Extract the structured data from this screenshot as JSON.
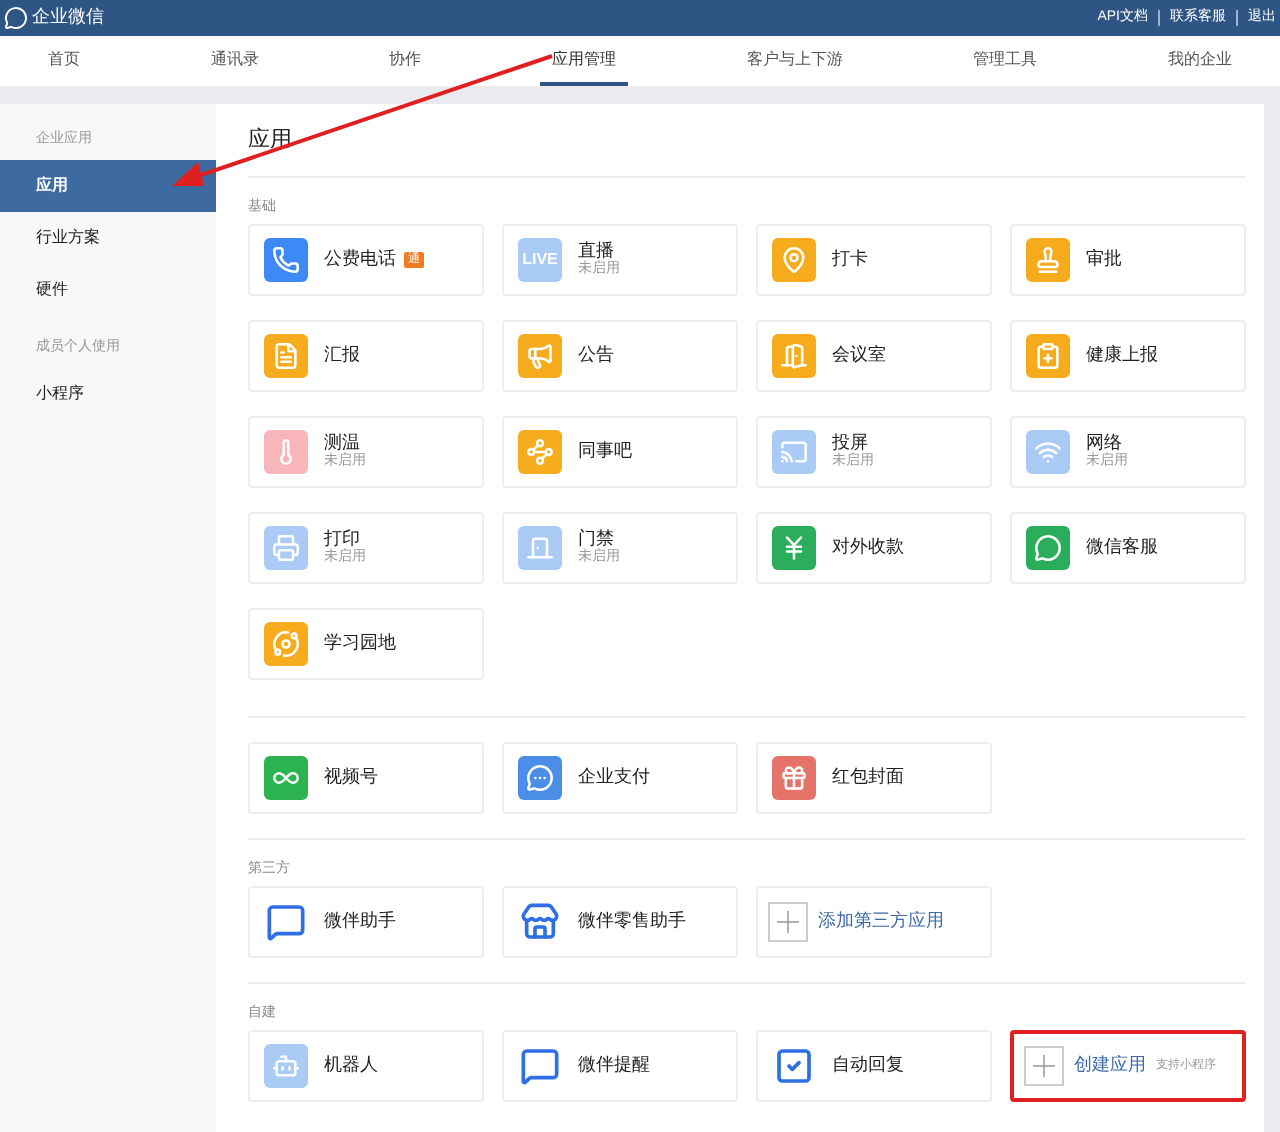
{
  "header": {
    "logo_text": "企业微信",
    "links": [
      "API文档",
      "联系客服",
      "退出"
    ]
  },
  "nav": {
    "tabs": [
      {
        "label": "首页",
        "selected": false
      },
      {
        "label": "通讯录",
        "selected": false
      },
      {
        "label": "协作",
        "selected": false
      },
      {
        "label": "应用管理",
        "selected": true
      },
      {
        "label": "客户与上下游",
        "selected": false
      },
      {
        "label": "管理工具",
        "selected": false
      },
      {
        "label": "我的企业",
        "selected": false
      }
    ]
  },
  "sidebar": {
    "items": [
      {
        "kind": "heading",
        "label": "企业应用"
      },
      {
        "kind": "item",
        "label": "应用",
        "selected": true
      },
      {
        "kind": "item",
        "label": "行业方案",
        "selected": false
      },
      {
        "kind": "item",
        "label": "硬件",
        "selected": false
      },
      {
        "kind": "heading",
        "label": "成员个人使用"
      },
      {
        "kind": "item",
        "label": "小程序",
        "selected": false
      }
    ]
  },
  "content": {
    "title": "应用",
    "sections": [
      {
        "heading": "基础",
        "cards": [
          {
            "kind": "app",
            "name": "公费电话",
            "badge": "通",
            "color": "#3d8af7",
            "highlighted": false
          },
          {
            "kind": "app",
            "name": "直播",
            "status": "未启用",
            "icon_text": "LIVE",
            "color": "#a9cbf6",
            "highlighted": false
          },
          {
            "kind": "app",
            "name": "打卡",
            "color": "#f7ac1e",
            "highlighted": false
          },
          {
            "kind": "app",
            "name": "审批",
            "color": "#f7ac1e",
            "highlighted": false
          },
          {
            "kind": "app",
            "name": "汇报",
            "color": "#f7ac1e",
            "highlighted": false
          },
          {
            "kind": "app",
            "name": "公告",
            "color": "#f7ac1e",
            "highlighted": false
          },
          {
            "kind": "app",
            "name": "会议室",
            "color": "#f7ac1e",
            "highlighted": false
          },
          {
            "kind": "app",
            "name": "健康上报",
            "color": "#f7ac1e",
            "highlighted": false
          },
          {
            "kind": "app",
            "name": "测温",
            "status": "未启用",
            "color": "#f8b6ba",
            "highlighted": false
          },
          {
            "kind": "app",
            "name": "同事吧",
            "color": "#f7ac1e",
            "highlighted": false
          },
          {
            "kind": "app",
            "name": "投屏",
            "status": "未启用",
            "color": "#a9cbf6",
            "highlighted": false
          },
          {
            "kind": "app",
            "name": "网络",
            "status": "未启用",
            "color": "#a9cbf6",
            "highlighted": false
          },
          {
            "kind": "app",
            "name": "打印",
            "status": "未启用",
            "color": "#a9cbf6",
            "highlighted": false
          },
          {
            "kind": "app",
            "name": "门禁",
            "status": "未启用",
            "color": "#a9cbf6",
            "highlighted": false
          },
          {
            "kind": "app",
            "name": "对外收款",
            "color": "#2aae5b",
            "highlighted": false
          },
          {
            "kind": "app",
            "name": "微信客服",
            "color": "#2aae5b",
            "highlighted": false
          },
          {
            "kind": "app",
            "name": "学习园地",
            "color": "#f7ac1e",
            "highlighted": false
          }
        ]
      },
      {
        "cards": [
          {
            "kind": "app",
            "name": "视频号",
            "color": "#2bb34f",
            "highlighted": false
          },
          {
            "kind": "app",
            "name": "企业支付",
            "color": "#4a8ee8",
            "highlighted": false
          },
          {
            "kind": "app",
            "name": "红包封面",
            "color": "#e5736a",
            "highlighted": false
          }
        ]
      },
      {
        "heading": "第三方",
        "cards": [
          {
            "kind": "app",
            "name": "微伴助手",
            "color": "#ffffff",
            "highlighted": false
          },
          {
            "kind": "app",
            "name": "微伴零售助手",
            "color": "#ffffff",
            "highlighted": false
          },
          {
            "kind": "add",
            "name": "添加第三方应用",
            "highlighted": false
          }
        ]
      },
      {
        "heading": "自建",
        "cards": [
          {
            "kind": "app",
            "name": "机器人",
            "color": "#a9cbf6",
            "highlighted": false
          },
          {
            "kind": "app",
            "name": "微伴提醒",
            "color": "#ffffff",
            "highlighted": false
          },
          {
            "kind": "app",
            "name": "自动回复",
            "color": "#ffffff",
            "highlighted": false
          },
          {
            "kind": "add",
            "name": "创建应用",
            "hint": "支持小程序",
            "highlighted": true
          }
        ]
      }
    ]
  }
}
